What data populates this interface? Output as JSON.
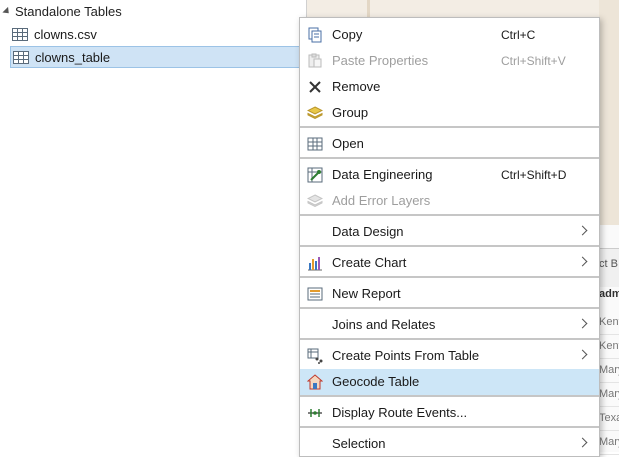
{
  "contents_pane": {
    "group_title": "Standalone Tables",
    "items": [
      {
        "label": "clowns.csv",
        "selected": false
      },
      {
        "label": "clowns_table",
        "selected": true
      }
    ]
  },
  "background_table": {
    "header_top": "ct B",
    "header_bottom": "adm",
    "cells": [
      "Kent",
      "Kent",
      "Mary",
      "Mary",
      "Texa",
      "Mary"
    ]
  },
  "context_menu": {
    "items": [
      {
        "label": "Copy",
        "shortcut": "Ctrl+C",
        "icon": "copy-icon",
        "enabled": true
      },
      {
        "label": "Paste Properties",
        "shortcut": "Ctrl+Shift+V",
        "icon": "paste-properties-icon",
        "enabled": false
      },
      {
        "label": "Remove",
        "shortcut": "",
        "icon": "remove-icon",
        "enabled": true
      },
      {
        "label": "Group",
        "shortcut": "",
        "icon": "group-icon",
        "enabled": true
      },
      {
        "label": "Open",
        "shortcut": "",
        "icon": "table-icon",
        "enabled": true
      },
      {
        "label": "Data Engineering",
        "shortcut": "Ctrl+Shift+D",
        "icon": "data-engineering-icon",
        "enabled": true
      },
      {
        "label": "Add Error Layers",
        "shortcut": "",
        "icon": "error-layers-icon",
        "enabled": false
      },
      {
        "label": "Data Design",
        "shortcut": "",
        "icon": "",
        "enabled": true,
        "submenu": true
      },
      {
        "label": "Create Chart",
        "shortcut": "",
        "icon": "chart-icon",
        "enabled": true,
        "submenu": true
      },
      {
        "label": "New Report",
        "shortcut": "",
        "icon": "report-icon",
        "enabled": true
      },
      {
        "label": "Joins and Relates",
        "shortcut": "",
        "icon": "",
        "enabled": true,
        "submenu": true
      },
      {
        "label": "Create Points From Table",
        "shortcut": "",
        "icon": "points-from-table-icon",
        "enabled": true,
        "submenu": true
      },
      {
        "label": "Geocode Table",
        "shortcut": "",
        "icon": "geocode-icon",
        "enabled": true,
        "highlighted": true
      },
      {
        "label": "Display Route Events...",
        "shortcut": "",
        "icon": "route-events-icon",
        "enabled": true
      },
      {
        "label": "Selection",
        "shortcut": "",
        "icon": "",
        "enabled": true,
        "submenu": true
      }
    ]
  },
  "colors": {
    "selection_bg": "#cfe3f5",
    "menu_hover_bg": "#cde6f7",
    "disabled_text": "#9e9e9e"
  }
}
